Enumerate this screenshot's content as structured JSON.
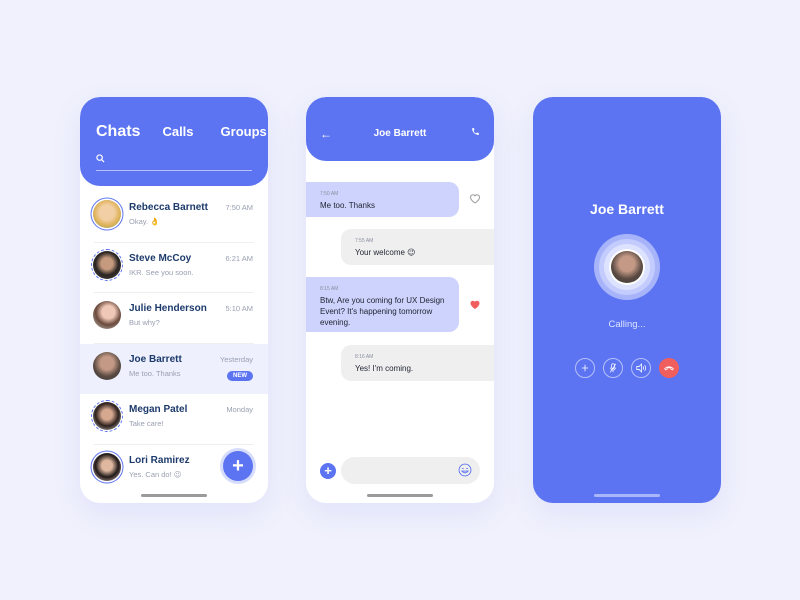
{
  "colors": {
    "accent": "#5c74f2",
    "end_call": "#f15e5e",
    "heart": "#f15e5e",
    "background": "#f0f1fc"
  },
  "chats_screen": {
    "tabs": [
      {
        "label": "Chats",
        "active": true
      },
      {
        "label": "Calls",
        "active": false
      },
      {
        "label": "Groups",
        "active": false
      }
    ],
    "search": {
      "placeholder": "",
      "icon": "search-icon"
    },
    "chats": [
      {
        "name": "Rebecca Barnett",
        "message": "Okay. 👌",
        "time": "7:50 AM",
        "selected": false,
        "badge": ""
      },
      {
        "name": "Steve McCoy",
        "message": "IKR. See you soon.",
        "time": "6:21 AM",
        "selected": false,
        "badge": ""
      },
      {
        "name": "Julie Henderson",
        "message": "But why?",
        "time": "5:10 AM",
        "selected": false,
        "badge": ""
      },
      {
        "name": "Joe Barrett",
        "message": "Me too. Thanks",
        "time": "Yesterday",
        "selected": true,
        "badge": "NEW"
      },
      {
        "name": "Megan Patel",
        "message": "Take care!",
        "time": "Monday",
        "selected": false,
        "badge": ""
      },
      {
        "name": "Lori Ramirez",
        "message": "Yes. Can do! 😉",
        "time": "",
        "selected": false,
        "badge": ""
      }
    ],
    "fab_icon": "+"
  },
  "conversation_screen": {
    "title": "Joe Barrett",
    "back_icon": "←",
    "messages": [
      {
        "direction": "in",
        "time": "7:50 AM",
        "text": "Me too. Thanks",
        "liked": false
      },
      {
        "direction": "out",
        "time": "7:55 AM",
        "text": "Your welcome 😉"
      },
      {
        "direction": "in",
        "time": "8:15 AM",
        "text": "Btw, Are you coming for UX Design Event? It's happening tomorrow evening.",
        "liked": true
      },
      {
        "direction": "out",
        "time": "8:16 AM",
        "text": "Yes! I'm coming."
      }
    ],
    "composer": {
      "placeholder": "",
      "add_icon": "+"
    }
  },
  "call_screen": {
    "name": "Joe Barrett",
    "status": "Calling...",
    "actions": [
      "add",
      "mute",
      "speaker",
      "end-call"
    ]
  }
}
